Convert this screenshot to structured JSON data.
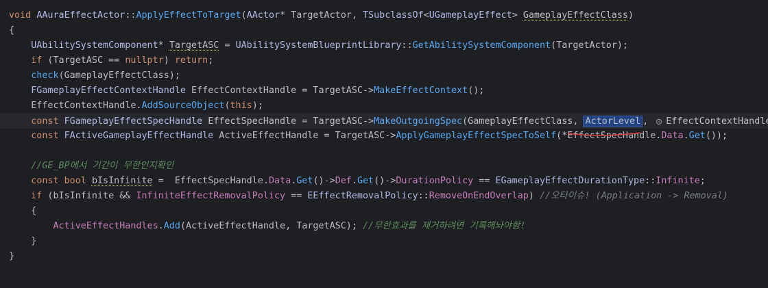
{
  "code": {
    "l1": {
      "kw": "void",
      "cls": "AAuraEffectActor",
      "sep": "::",
      "fn": "ApplyEffectToTarget",
      "p1": "(",
      "t1": "AActor",
      "p2": "* TargetActor, ",
      "t2": "TSubclassOf",
      "p3": "<",
      "t3": "UGameplayEffect",
      "p4": "> ",
      "v1": "GameplayEffectClass",
      "p5": ")"
    },
    "l2": {
      "brace": "{"
    },
    "l3": {
      "t": "UAbilitySystemComponent",
      "p1": "* ",
      "v": "TargetASC",
      "p2": " = ",
      "c": "UAbilitySystemBlueprintLibrary",
      "sep": "::",
      "fn": "GetAbilitySystemComponent",
      "p3": "(TargetActor);"
    },
    "l4": {
      "kw": "if",
      "p1": " (TargetASC == ",
      "kw2": "nullptr",
      "p2": ") ",
      "kw3": "return",
      "p3": ";"
    },
    "l5": {
      "mac": "check",
      "p1": "(GameplayEffectClass);"
    },
    "l6": {
      "t": "FGameplayEffectContextHandle",
      "p1": " EffectContextHandle = TargetASC->",
      "fn": "MakeEffectContext",
      "p2": "();"
    },
    "l7": {
      "p1": "EffectContextHandle.",
      "fn": "AddSourceObject",
      "p2": "(",
      "kw": "this",
      "p3": ");"
    },
    "l8": {
      "kw": "const",
      "t": " FGameplayEffectSpecHandle",
      "p1": " EffectSpecHandle = TargetASC->",
      "fn": "MakeOutgoingSpec",
      "p2": "(GameplayEffectClass, ",
      "sel": "ActorLevel",
      "p3": ", ",
      "hint": "EffectContextHandle)"
    },
    "l9": {
      "kw": "const",
      "t": " FActiveGameplayEffectHandle",
      "p1": " ActiveEffectHandle = TargetASC->",
      "fn": "ApplyGameplayEffectSpecToSelf",
      "p2": "(*EffectSpecHandle.",
      "m": "Data",
      "p3": ".",
      "fn2": "Get",
      "p4": "());"
    },
    "l10": {},
    "l11": {
      "cm": "//GE_BP에서 기간이 무한인지확인"
    },
    "l12": {
      "kw": "const",
      "kw2": " bool",
      "p0": " ",
      "v": "bIsInfinite",
      "p1": " =  EffectSpecHandle.",
      "m": "Data",
      "p2": ".",
      "fn": "Get",
      "p3": "()->",
      "m2": "Def",
      "p4": ".",
      "fn2": "Get",
      "p5": "()->",
      "m3": "DurationPolicy",
      "p6": " == ",
      "t": "EGameplayEffectDurationType",
      "sep": "::",
      "e": "Infinite",
      "p7": ";"
    },
    "l13": {
      "kw": "if",
      "p1": " (bIsInfinite && ",
      "g": "InfiniteEffectRemovalPolicy",
      "p2": " == ",
      "t": "EEffectRemovalPolicy",
      "sep": "::",
      "e": "RemoveOnEndOverlap",
      "p3": ") ",
      "cm": "//오타이슈! (Application -> Removal)"
    },
    "l14": {
      "brace": "{"
    },
    "l15": {
      "g": "ActiveEffectHandles",
      "p1": ".",
      "fn": "Add",
      "p2": "(ActiveEffectHandle, TargetASC); ",
      "cm": "//무한효과를 제거하려면 기록해놔야함!"
    },
    "l16": {
      "brace": "}"
    },
    "l17": {
      "brace": "}"
    }
  },
  "colors": {
    "background": "#1e1f22",
    "keyword": "#cf8e6d",
    "function": "#56a8f5",
    "type": "#b5b6e3",
    "comment": "#7a7e85",
    "member": "#c77dbb",
    "selection": "#214283",
    "error_underline": "#e04040"
  }
}
